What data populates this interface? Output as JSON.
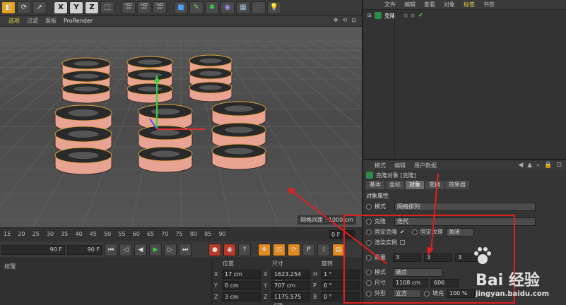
{
  "toolbar": {
    "axis_x": "X",
    "axis_y": "Y",
    "axis_z": "Z"
  },
  "viewport_menu": {
    "items": [
      "选项",
      "过滤",
      "面板"
    ],
    "renderer": "ProRender"
  },
  "viewport": {
    "grid_distance": "网格间距 : 1000 cm"
  },
  "timeline": {
    "ticks": [
      "15",
      "20",
      "25",
      "30",
      "35",
      "40",
      "45",
      "50",
      "55",
      "60",
      "65",
      "70",
      "75",
      "80",
      "85",
      "90"
    ],
    "current_frame": "0 F"
  },
  "playbar": {
    "start_field": "90 F",
    "end_field": "90 F"
  },
  "bottom_left": {
    "label": "校理"
  },
  "coords": {
    "headers": [
      "位置",
      "尺寸",
      "旋转"
    ],
    "rows": [
      {
        "pos_axis": "X",
        "pos": "17 cm",
        "size_axis": "X",
        "size": "1623.254 cm",
        "rot_axis": "H",
        "rot": "1 °"
      },
      {
        "pos_axis": "Y",
        "pos": "0 cm",
        "size_axis": "Y",
        "size": "707 cm",
        "rot_axis": "P",
        "rot": "0 °"
      },
      {
        "pos_axis": "Z",
        "pos": "3 cm",
        "size_axis": "Z",
        "size": "1175.575 cm",
        "rot_axis": "B",
        "rot": "0 °"
      }
    ]
  },
  "object_manager": {
    "menu": [
      "文件",
      "编辑",
      "查看",
      "对象",
      "标签",
      "书签"
    ],
    "active_menu": "标签",
    "object_label": "克隆"
  },
  "attribute_manager": {
    "menu": [
      "模式",
      "编辑",
      "用户数据"
    ],
    "title": "克隆对象 [克隆]",
    "tabs": [
      "基本",
      "坐标",
      "对象",
      "变换",
      "效果器"
    ],
    "active_tab": "对象",
    "section": "对象属性",
    "mode_label": "模式",
    "mode_value": "网格排列",
    "clone_label": "克隆",
    "clone_value": "迭代",
    "fix_clone_label": "固定克隆",
    "fix_texture_label": "固定纹理",
    "fix_texture_value": "关闭",
    "render_instance_label": "渲染实例",
    "count_label": "数量",
    "count_values": [
      "3",
      "3",
      "3"
    ],
    "mode2_label": "模式",
    "mode2_value": "端点",
    "size_label": "尺寸",
    "size_values": [
      "1108 cm",
      "606"
    ],
    "shape_label": "外形",
    "shape_value": "立方",
    "fill_label": "填充",
    "fill_value": "100 %"
  },
  "watermark": {
    "brand": "Bai 经验",
    "url": "jingyan.baidu.com"
  },
  "colors": {
    "accent": "#e8d24a",
    "highlight": "#e02020",
    "torus_fill": "#e8a393"
  }
}
